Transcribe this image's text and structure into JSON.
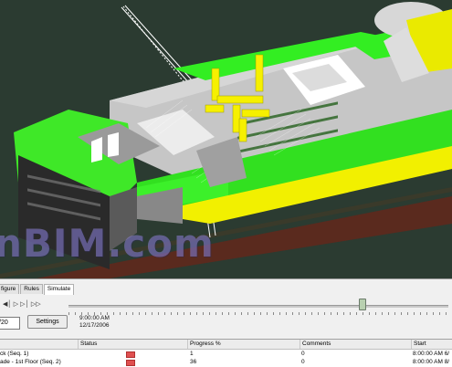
{
  "watermark": {
    "text": "nBIM.com"
  },
  "panel": {
    "tabs": [
      "figure",
      "Rules",
      "Simulate"
    ],
    "active_tab": "Simulate",
    "transport_icons": [
      "step-back-icon",
      "play-icon",
      "step-forward-icon",
      "skip-end-icon"
    ],
    "date_value": "/20",
    "settings_label": "Settings",
    "time": "9:00:00 AM",
    "date": "12/17/2006",
    "table": {
      "headers": [
        "Status",
        "Progress %",
        "Comments",
        "Start"
      ],
      "rows": [
        {
          "name": "ck (Seq. 1)",
          "progress": "1",
          "comments": "0",
          "start": "8:00:00 AM 6/"
        },
        {
          "name": "ade - 1st Floor (Seq. 2)",
          "progress": "36",
          "comments": "0",
          "start": "8:00:00 AM 8/"
        }
      ]
    }
  },
  "colors": {
    "ground": "#2a3a30",
    "road": "#5a2a20",
    "highlight": "#33ee22",
    "active_task": "#f2f000",
    "building": "#bdbdbd",
    "status_bar": "#e05050"
  }
}
